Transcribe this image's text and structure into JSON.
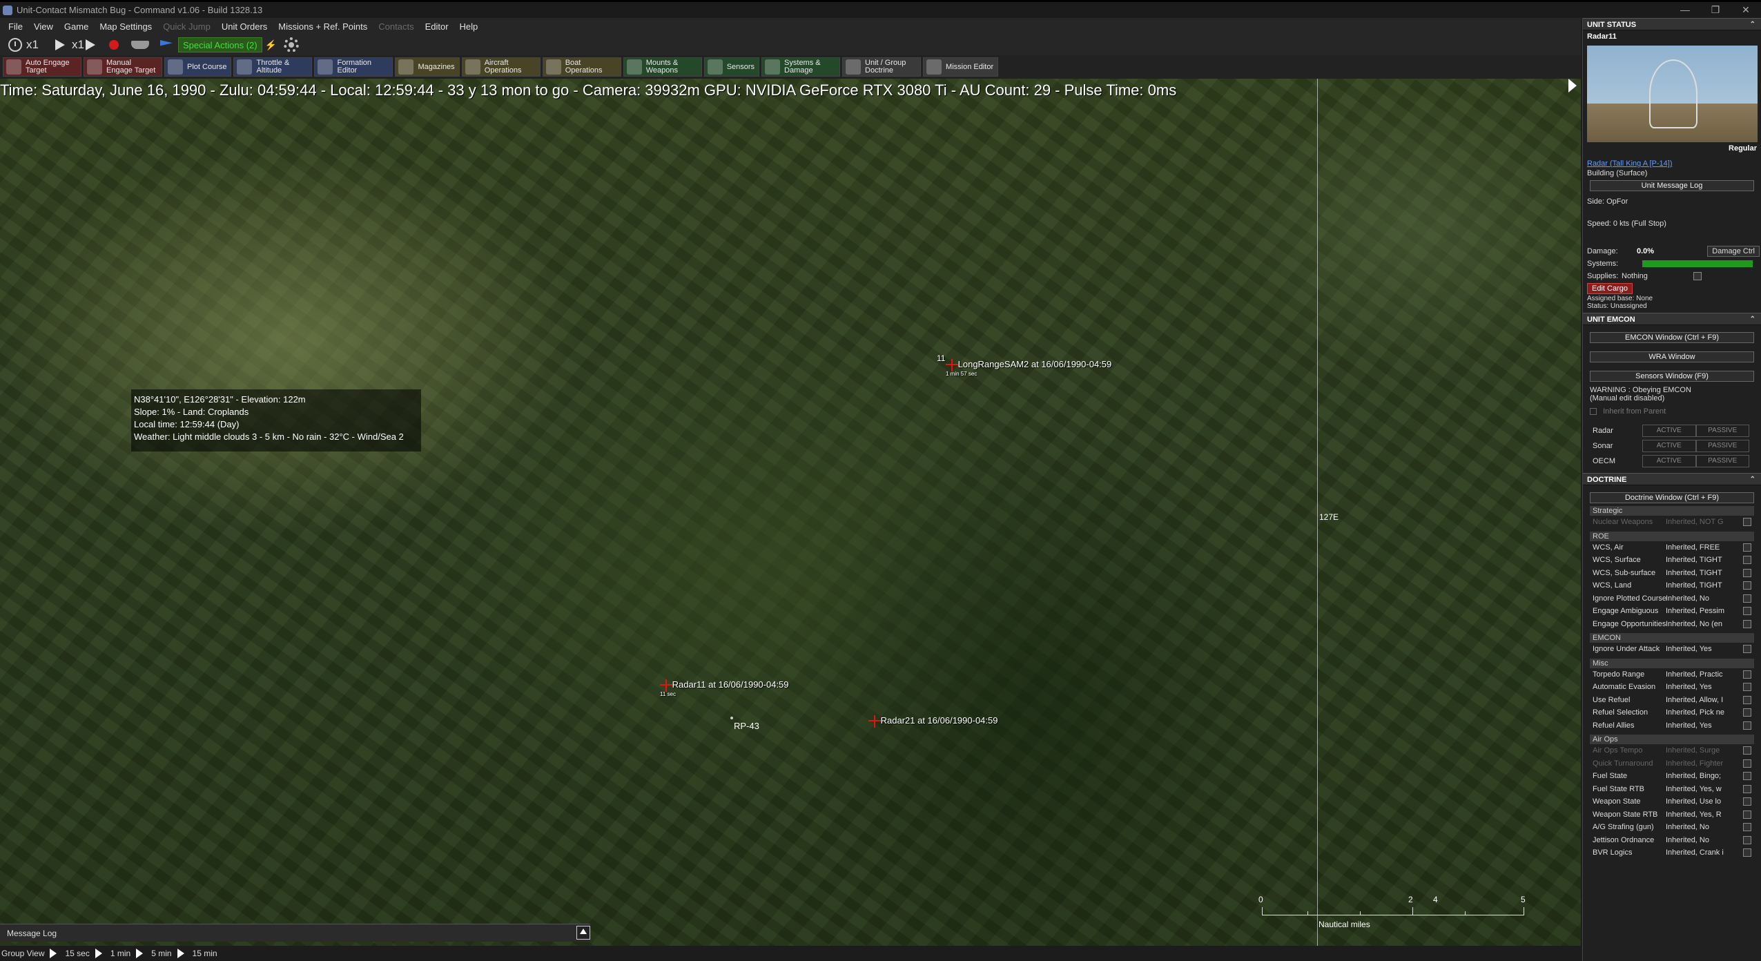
{
  "window": {
    "title": "Unit-Contact Mismatch Bug - Command v1.06 - Build 1328.13"
  },
  "menu": [
    {
      "label": "File",
      "enabled": true
    },
    {
      "label": "View",
      "enabled": true
    },
    {
      "label": "Game",
      "enabled": true
    },
    {
      "label": "Map Settings",
      "enabled": true
    },
    {
      "label": "Quick Jump",
      "enabled": false
    },
    {
      "label": "Unit Orders",
      "enabled": true
    },
    {
      "label": "Missions + Ref. Points",
      "enabled": true
    },
    {
      "label": "Contacts",
      "enabled": false
    },
    {
      "label": "Editor",
      "enabled": true
    },
    {
      "label": "Help",
      "enabled": true
    }
  ],
  "toolbar1": {
    "speed1": "x1",
    "speed2": "x1",
    "special_actions": "Special Actions (2)"
  },
  "toolbar2": [
    {
      "label": "Auto Engage Target",
      "style": "red"
    },
    {
      "label": "Manual Engage Target",
      "style": "red"
    },
    {
      "label": "Plot Course",
      "style": "blue"
    },
    {
      "label": "Throttle & Altitude",
      "style": "blue"
    },
    {
      "label": "Formation Editor",
      "style": "blue"
    },
    {
      "label": "Magazines",
      "style": "olive"
    },
    {
      "label": "Aircraft Operations",
      "style": "olive"
    },
    {
      "label": "Boat Operations",
      "style": "olive"
    },
    {
      "label": "Mounts & Weapons",
      "style": "green"
    },
    {
      "label": "Sensors",
      "style": "green"
    },
    {
      "label": "Systems & Damage",
      "style": "green"
    },
    {
      "label": "Unit / Group Doctrine",
      "style": "grey"
    },
    {
      "label": "Mission Editor",
      "style": "grey"
    }
  ],
  "map": {
    "status_line": "Time: Saturday, June 16, 1990 - Zulu: 04:59:44 - Local: 12:59:44 - 33 y 13 mon to go -  Camera: 39932m  GPU: NVIDIA GeForce RTX 3080 Ti - AU Count: 29 - Pulse Time: 0ms",
    "cursor_info": [
      "N38°41'10\", E126°28'31\" - Elevation: 122m",
      "Slope: 1%  - Land: Croplands",
      "Local time: 12:59:44 (Day)",
      "Weather: Light middle clouds 3 - 5 km - No rain - 32°C - Wind/Sea 2"
    ],
    "meridian_label": "127E",
    "units": [
      {
        "label": "LongRangeSAM2 at 16/06/1990-04:59",
        "id": "11",
        "sub": "1 min 57 sec"
      },
      {
        "label": "Radar11 at 16/06/1990-04:59",
        "id": "",
        "sub": "11 sec"
      },
      {
        "label": "Radar21 at 16/06/1990-04:59",
        "id": "",
        "sub": ""
      }
    ],
    "ref_point": "RP-43",
    "scale": {
      "ticks": [
        "0",
        "2",
        "4",
        "5"
      ],
      "unit": "Nautical miles"
    },
    "message_log": "Message Log"
  },
  "bottom_bar": {
    "group_view": "Group View",
    "steps": [
      "15 sec",
      "1 min",
      "5 min",
      "15 min"
    ]
  },
  "panel": {
    "unit_status": {
      "header": "UNIT STATUS",
      "name": "Radar11",
      "proficiency": "Regular",
      "type_link": "Radar (Tall King A [P-14])",
      "category": "Building (Surface)",
      "message_log_btn": "Unit Message Log",
      "side": "Side: OpFor",
      "speed": "Speed: 0 kts (Full Stop)",
      "damage_label": "Damage:",
      "damage_value": "0.0%",
      "damage_btn": "Damage Ctrl",
      "systems_label": "Systems:",
      "systems_health": 1.0,
      "supplies_label": "Supplies:",
      "supplies_value": "Nothing",
      "edit_cargo_btn": "Edit Cargo",
      "assigned_base": "Assigned base: None",
      "status": "Status: Unassigned"
    },
    "unit_emcon": {
      "header": "UNIT EMCON",
      "emcon_btn": "EMCON Window (Ctrl + F9)",
      "wra_btn": "WRA Window",
      "sensors_btn": "Sensors Window (F9)",
      "warning1": "WARNING : Obeying EMCON",
      "warning2": "(Manual edit disabled)",
      "inherit": "Inherit from Parent",
      "rows": [
        {
          "label": "Radar",
          "active": "ACTIVE",
          "passive": "PASSIVE"
        },
        {
          "label": "Sonar",
          "active": "ACTIVE",
          "passive": "PASSIVE"
        },
        {
          "label": "OECM",
          "active": "ACTIVE",
          "passive": "PASSIVE"
        }
      ]
    },
    "doctrine": {
      "header": "DOCTRINE",
      "doctrine_btn": "Doctrine Window (Ctrl + F9)",
      "sections": [
        {
          "title": "Strategic",
          "rows": [
            {
              "label": "Nuclear Weapons",
              "value": "Inherited, NOT G",
              "dim": true
            }
          ]
        },
        {
          "title": "ROE",
          "rows": [
            {
              "label": "WCS, Air",
              "value": "Inherited, FREE",
              "dim": false
            },
            {
              "label": "WCS, Surface",
              "value": "Inherited, TIGHT",
              "dim": false
            },
            {
              "label": "WCS, Sub-surface",
              "value": "Inherited, TIGHT",
              "dim": false
            },
            {
              "label": "WCS, Land",
              "value": "Inherited, TIGHT",
              "dim": false
            },
            {
              "label": "Ignore Plotted Course",
              "value": "Inherited, No",
              "dim": false
            },
            {
              "label": "Engage Ambiguous",
              "value": "Inherited, Pessim",
              "dim": false
            },
            {
              "label": "Engage Opportunities",
              "value": "Inherited, No (en",
              "dim": false
            }
          ]
        },
        {
          "title": "EMCON",
          "rows": [
            {
              "label": "Ignore Under Attack",
              "value": "Inherited, Yes",
              "dim": false
            }
          ]
        },
        {
          "title": "Misc",
          "rows": [
            {
              "label": "Torpedo Range",
              "value": "Inherited, Practic",
              "dim": false
            },
            {
              "label": "Automatic Evasion",
              "value": "Inherited, Yes",
              "dim": false
            },
            {
              "label": "Use Refuel",
              "value": "Inherited, Allow, I",
              "dim": false
            },
            {
              "label": "Refuel Selection",
              "value": "Inherited, Pick ne",
              "dim": false
            },
            {
              "label": "Refuel Allies",
              "value": "Inherited, Yes",
              "dim": false
            }
          ]
        },
        {
          "title": "Air Ops",
          "rows": [
            {
              "label": "Air Ops Tempo",
              "value": "Inherited, Surge",
              "dim": true
            },
            {
              "label": "Quick Turnaround",
              "value": "Inherited, Fighter",
              "dim": true
            },
            {
              "label": "Fuel State",
              "value": "Inherited, Bingo;",
              "dim": false
            },
            {
              "label": "Fuel State RTB",
              "value": "Inherited, Yes, w",
              "dim": false
            },
            {
              "label": "Weapon State",
              "value": "Inherited, Use lo",
              "dim": false
            },
            {
              "label": "Weapon State RTB",
              "value": "Inherited, Yes, R",
              "dim": false
            },
            {
              "label": "A/G Strafing (gun)",
              "value": "Inherited, No",
              "dim": false
            },
            {
              "label": "Jettison Ordnance",
              "value": "Inherited, No",
              "dim": false
            },
            {
              "label": "BVR Logics",
              "value": "Inherited, Crank i",
              "dim": false
            }
          ]
        }
      ]
    }
  },
  "colors": {
    "hostile": "#e01515",
    "systems_bar": "#1f9a1f",
    "link": "#5ea0ff"
  }
}
